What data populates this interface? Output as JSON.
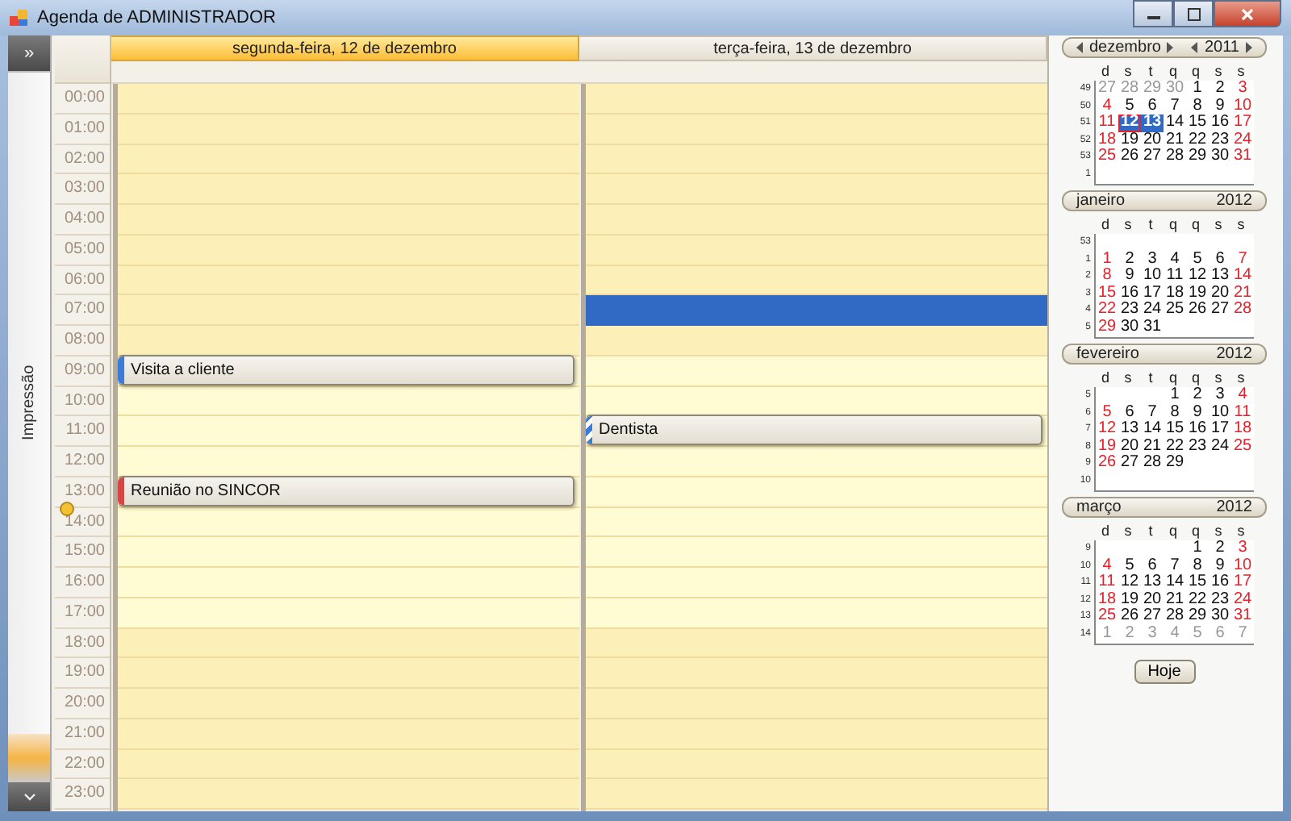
{
  "window": {
    "title": "Agenda de ADMINISTRADOR"
  },
  "sidebar": {
    "expand_button": "»",
    "tab": "Impressão"
  },
  "hours": [
    {
      "label": "00:00",
      "working": false,
      "now": false
    },
    {
      "label": "01:00",
      "working": false,
      "now": false
    },
    {
      "label": "02:00",
      "working": false,
      "now": false
    },
    {
      "label": "03:00",
      "working": false,
      "now": false
    },
    {
      "label": "04:00",
      "working": false,
      "now": false
    },
    {
      "label": "05:00",
      "working": false,
      "now": false
    },
    {
      "label": "06:00",
      "working": false,
      "now": false
    },
    {
      "label": "07:00",
      "working": false,
      "now": false
    },
    {
      "label": "08:00",
      "working": false,
      "now": false
    },
    {
      "label": "09:00",
      "working": true,
      "now": false
    },
    {
      "label": "10:00",
      "working": true,
      "now": false
    },
    {
      "label": "11:00",
      "working": true,
      "now": false
    },
    {
      "label": "12:00",
      "working": true,
      "now": false
    },
    {
      "label": "13:00",
      "working": true,
      "now": false
    },
    {
      "label": "14:00",
      "working": true,
      "now": true
    },
    {
      "label": "15:00",
      "working": true,
      "now": false
    },
    {
      "label": "16:00",
      "working": true,
      "now": false
    },
    {
      "label": "17:00",
      "working": true,
      "now": false
    },
    {
      "label": "18:00",
      "working": false,
      "now": false
    },
    {
      "label": "19:00",
      "working": false,
      "now": false
    },
    {
      "label": "20:00",
      "working": false,
      "now": false
    },
    {
      "label": "21:00",
      "working": false,
      "now": false
    },
    {
      "label": "22:00",
      "working": false,
      "now": false
    },
    {
      "label": "23:00",
      "working": false,
      "now": false
    }
  ],
  "days": [
    {
      "header": "segunda-feira, 12 de dezembro",
      "selected": true,
      "slots": [
        {
          "selected": false
        },
        {
          "selected": false
        },
        {
          "selected": false
        },
        {
          "selected": false
        },
        {
          "selected": false
        },
        {
          "selected": false
        },
        {
          "selected": false
        },
        {
          "selected": false
        },
        {
          "selected": false
        },
        {
          "selected": false,
          "event": {
            "title": "Visita a cliente",
            "kind": "solid",
            "color": "#3d7bd9"
          }
        },
        {
          "selected": false
        },
        {
          "selected": false
        },
        {
          "selected": false
        },
        {
          "selected": false,
          "event": {
            "title": "Reunião no SINCOR",
            "kind": "solid",
            "color": "#d94545"
          }
        },
        {
          "selected": false
        },
        {
          "selected": false
        },
        {
          "selected": false
        },
        {
          "selected": false
        },
        {
          "selected": false
        },
        {
          "selected": false
        },
        {
          "selected": false
        },
        {
          "selected": false
        },
        {
          "selected": false
        },
        {
          "selected": false
        }
      ]
    },
    {
      "header": "terça-feira, 13 de dezembro",
      "selected": false,
      "slots": [
        {
          "selected": false
        },
        {
          "selected": false
        },
        {
          "selected": false
        },
        {
          "selected": false
        },
        {
          "selected": false
        },
        {
          "selected": false
        },
        {
          "selected": false
        },
        {
          "selected": true
        },
        {
          "selected": false
        },
        {
          "selected": false
        },
        {
          "selected": false
        },
        {
          "selected": false,
          "event": {
            "title": "Dentista",
            "kind": "striped",
            "color": "#3d7bd9"
          }
        },
        {
          "selected": false
        },
        {
          "selected": false
        },
        {
          "selected": false
        },
        {
          "selected": false
        },
        {
          "selected": false
        },
        {
          "selected": false
        },
        {
          "selected": false
        },
        {
          "selected": false
        },
        {
          "selected": false
        },
        {
          "selected": false
        },
        {
          "selected": false
        },
        {
          "selected": false
        }
      ]
    }
  ],
  "months": [
    {
      "month": "dezembro",
      "year": "2011",
      "navigation": true,
      "weekdays": [
        "d",
        "s",
        "t",
        "q",
        "q",
        "s",
        "s"
      ],
      "weeks": [
        {
          "week": "49",
          "days": [
            {
              "n": "27",
              "kind": "other",
              "selected": false
            },
            {
              "n": "28",
              "kind": "other",
              "selected": false
            },
            {
              "n": "29",
              "kind": "other",
              "selected": false
            },
            {
              "n": "30",
              "kind": "other",
              "selected": false
            },
            {
              "n": "1",
              "kind": "day",
              "selected": false
            },
            {
              "n": "2",
              "kind": "day",
              "selected": false
            },
            {
              "n": "3",
              "kind": "day",
              "selected": false
            }
          ]
        },
        {
          "week": "50",
          "days": [
            {
              "n": "4",
              "kind": "day",
              "selected": false
            },
            {
              "n": "5",
              "kind": "day",
              "selected": false
            },
            {
              "n": "6",
              "kind": "day",
              "selected": false
            },
            {
              "n": "7",
              "kind": "day",
              "selected": false
            },
            {
              "n": "8",
              "kind": "day",
              "selected": false
            },
            {
              "n": "9",
              "kind": "day",
              "selected": false
            },
            {
              "n": "10",
              "kind": "day",
              "selected": false
            }
          ]
        },
        {
          "week": "51",
          "days": [
            {
              "n": "11",
              "kind": "day",
              "selected": false
            },
            {
              "n": "12",
              "kind": "today",
              "selected": true
            },
            {
              "n": "13",
              "kind": "day",
              "selected": true
            },
            {
              "n": "14",
              "kind": "day",
              "selected": false
            },
            {
              "n": "15",
              "kind": "day",
              "selected": false
            },
            {
              "n": "16",
              "kind": "day",
              "selected": false
            },
            {
              "n": "17",
              "kind": "day",
              "selected": false
            }
          ]
        },
        {
          "week": "52",
          "days": [
            {
              "n": "18",
              "kind": "day",
              "selected": false
            },
            {
              "n": "19",
              "kind": "day",
              "selected": false
            },
            {
              "n": "20",
              "kind": "day",
              "selected": false
            },
            {
              "n": "21",
              "kind": "day",
              "selected": false
            },
            {
              "n": "22",
              "kind": "day",
              "selected": false
            },
            {
              "n": "23",
              "kind": "day",
              "selected": false
            },
            {
              "n": "24",
              "kind": "day",
              "selected": false
            }
          ]
        },
        {
          "week": "53",
          "days": [
            {
              "n": "25",
              "kind": "day",
              "selected": false
            },
            {
              "n": "26",
              "kind": "day",
              "selected": false
            },
            {
              "n": "27",
              "kind": "day",
              "selected": false
            },
            {
              "n": "28",
              "kind": "day",
              "selected": false
            },
            {
              "n": "29",
              "kind": "day",
              "selected": false
            },
            {
              "n": "30",
              "kind": "day",
              "selected": false
            },
            {
              "n": "31",
              "kind": "day",
              "selected": false
            }
          ]
        },
        {
          "week": "1"
        }
      ]
    },
    {
      "month": "janeiro",
      "year": "2012",
      "navigation": false,
      "weekdays": [
        "d",
        "s",
        "t",
        "q",
        "q",
        "s",
        "s"
      ],
      "weeks": [
        {
          "week": "53"
        },
        {
          "week": "1",
          "days": [
            {
              "n": "1",
              "kind": "day",
              "selected": false
            },
            {
              "n": "2",
              "kind": "day",
              "selected": false
            },
            {
              "n": "3",
              "kind": "day",
              "selected": false
            },
            {
              "n": "4",
              "kind": "day",
              "selected": false
            },
            {
              "n": "5",
              "kind": "day",
              "selected": false
            },
            {
              "n": "6",
              "kind": "day",
              "selected": false
            },
            {
              "n": "7",
              "kind": "day",
              "selected": false
            }
          ]
        },
        {
          "week": "2",
          "days": [
            {
              "n": "8",
              "kind": "day",
              "selected": false
            },
            {
              "n": "9",
              "kind": "day",
              "selected": false
            },
            {
              "n": "10",
              "kind": "day",
              "selected": false
            },
            {
              "n": "11",
              "kind": "day",
              "selected": false
            },
            {
              "n": "12",
              "kind": "day",
              "selected": false
            },
            {
              "n": "13",
              "kind": "day",
              "selected": false
            },
            {
              "n": "14",
              "kind": "day",
              "selected": false
            }
          ]
        },
        {
          "week": "3",
          "days": [
            {
              "n": "15",
              "kind": "day",
              "selected": false
            },
            {
              "n": "16",
              "kind": "day",
              "selected": false
            },
            {
              "n": "17",
              "kind": "day",
              "selected": false
            },
            {
              "n": "18",
              "kind": "day",
              "selected": false
            },
            {
              "n": "19",
              "kind": "day",
              "selected": false
            },
            {
              "n": "20",
              "kind": "day",
              "selected": false
            },
            {
              "n": "21",
              "kind": "day",
              "selected": false
            }
          ]
        },
        {
          "week": "4",
          "days": [
            {
              "n": "22",
              "kind": "day",
              "selected": false
            },
            {
              "n": "23",
              "kind": "day",
              "selected": false
            },
            {
              "n": "24",
              "kind": "day",
              "selected": false
            },
            {
              "n": "25",
              "kind": "day",
              "selected": false
            },
            {
              "n": "26",
              "kind": "day",
              "selected": false
            },
            {
              "n": "27",
              "kind": "day",
              "selected": false
            },
            {
              "n": "28",
              "kind": "day",
              "selected": false
            }
          ]
        },
        {
          "week": "5",
          "days": [
            {
              "n": "29",
              "kind": "day",
              "selected": false
            },
            {
              "n": "30",
              "kind": "day",
              "selected": false
            },
            {
              "n": "31",
              "kind": "day",
              "selected": false
            }
          ]
        }
      ]
    },
    {
      "month": "fevereiro",
      "year": "2012",
      "navigation": false,
      "weekdays": [
        "d",
        "s",
        "t",
        "q",
        "q",
        "s",
        "s"
      ],
      "weeks": [
        {
          "week": "5",
          "days": [
            {
              "kind": "blank"
            },
            {
              "kind": "blank"
            },
            {
              "kind": "blank"
            },
            {
              "n": "1",
              "kind": "day",
              "selected": false
            },
            {
              "n": "2",
              "kind": "day",
              "selected": false
            },
            {
              "n": "3",
              "kind": "day",
              "selected": false
            },
            {
              "n": "4",
              "kind": "day",
              "selected": false
            }
          ]
        },
        {
          "week": "6",
          "days": [
            {
              "n": "5",
              "kind": "day",
              "selected": false
            },
            {
              "n": "6",
              "kind": "day",
              "selected": false
            },
            {
              "n": "7",
              "kind": "day",
              "selected": false
            },
            {
              "n": "8",
              "kind": "day",
              "selected": false
            },
            {
              "n": "9",
              "kind": "day",
              "selected": false
            },
            {
              "n": "10",
              "kind": "day",
              "selected": false
            },
            {
              "n": "11",
              "kind": "day",
              "selected": false
            }
          ]
        },
        {
          "week": "7",
          "days": [
            {
              "n": "12",
              "kind": "day",
              "selected": false
            },
            {
              "n": "13",
              "kind": "day",
              "selected": false
            },
            {
              "n": "14",
              "kind": "day",
              "selected": false
            },
            {
              "n": "15",
              "kind": "day",
              "selected": false
            },
            {
              "n": "16",
              "kind": "day",
              "selected": false
            },
            {
              "n": "17",
              "kind": "day",
              "selected": false
            },
            {
              "n": "18",
              "kind": "day",
              "selected": false
            }
          ]
        },
        {
          "week": "8",
          "days": [
            {
              "n": "19",
              "kind": "day",
              "selected": false
            },
            {
              "n": "20",
              "kind": "day",
              "selected": false
            },
            {
              "n": "21",
              "kind": "day",
              "selected": false
            },
            {
              "n": "22",
              "kind": "day",
              "selected": false
            },
            {
              "n": "23",
              "kind": "day",
              "selected": false
            },
            {
              "n": "24",
              "kind": "day",
              "selected": false
            },
            {
              "n": "25",
              "kind": "day",
              "selected": false
            }
          ]
        },
        {
          "week": "9",
          "days": [
            {
              "n": "26",
              "kind": "day",
              "selected": false
            },
            {
              "n": "27",
              "kind": "day",
              "selected": false
            },
            {
              "n": "28",
              "kind": "day",
              "selected": false
            },
            {
              "n": "29",
              "kind": "day",
              "selected": false
            }
          ]
        },
        {
          "week": "10"
        }
      ]
    },
    {
      "month": "março",
      "year": "2012",
      "navigation": false,
      "weekdays": [
        "d",
        "s",
        "t",
        "q",
        "q",
        "s",
        "s"
      ],
      "weeks": [
        {
          "week": "9",
          "days": [
            {
              "kind": "blank"
            },
            {
              "kind": "blank"
            },
            {
              "kind": "blank"
            },
            {
              "kind": "blank"
            },
            {
              "n": "1",
              "kind": "day",
              "selected": false
            },
            {
              "n": "2",
              "kind": "day",
              "selected": false
            },
            {
              "n": "3",
              "kind": "day",
              "selected": false
            }
          ]
        },
        {
          "week": "10",
          "days": [
            {
              "n": "4",
              "kind": "day",
              "selected": false
            },
            {
              "n": "5",
              "kind": "day",
              "selected": false
            },
            {
              "n": "6",
              "kind": "day",
              "selected": false
            },
            {
              "n": "7",
              "kind": "day",
              "selected": false
            },
            {
              "n": "8",
              "kind": "day",
              "selected": false
            },
            {
              "n": "9",
              "kind": "day",
              "selected": false
            },
            {
              "n": "10",
              "kind": "day",
              "selected": false
            }
          ]
        },
        {
          "week": "11",
          "days": [
            {
              "n": "11",
              "kind": "day",
              "selected": false
            },
            {
              "n": "12",
              "kind": "day",
              "selected": false
            },
            {
              "n": "13",
              "kind": "day",
              "selected": false
            },
            {
              "n": "14",
              "kind": "day",
              "selected": false
            },
            {
              "n": "15",
              "kind": "day",
              "selected": false
            },
            {
              "n": "16",
              "kind": "day",
              "selected": false
            },
            {
              "n": "17",
              "kind": "day",
              "selected": false
            }
          ]
        },
        {
          "week": "12",
          "days": [
            {
              "n": "18",
              "kind": "day",
              "selected": false
            },
            {
              "n": "19",
              "kind": "day",
              "selected": false
            },
            {
              "n": "20",
              "kind": "day",
              "selected": false
            },
            {
              "n": "21",
              "kind": "day",
              "selected": false
            },
            {
              "n": "22",
              "kind": "day",
              "selected": false
            },
            {
              "n": "23",
              "kind": "day",
              "selected": false
            },
            {
              "n": "24",
              "kind": "day",
              "selected": false
            }
          ]
        },
        {
          "week": "13",
          "days": [
            {
              "n": "25",
              "kind": "day",
              "selected": false
            },
            {
              "n": "26",
              "kind": "day",
              "selected": false
            },
            {
              "n": "27",
              "kind": "day",
              "selected": false
            },
            {
              "n": "28",
              "kind": "day",
              "selected": false
            },
            {
              "n": "29",
              "kind": "day",
              "selected": false
            },
            {
              "n": "30",
              "kind": "day",
              "selected": false
            },
            {
              "n": "31",
              "kind": "day",
              "selected": false
            }
          ]
        },
        {
          "week": "14",
          "days": [
            {
              "n": "1",
              "kind": "other",
              "selected": false
            },
            {
              "n": "2",
              "kind": "other",
              "selected": false
            },
            {
              "n": "3",
              "kind": "other",
              "selected": false
            },
            {
              "n": "4",
              "kind": "other",
              "selected": false
            },
            {
              "n": "5",
              "kind": "other",
              "selected": false
            },
            {
              "n": "6",
              "kind": "other",
              "selected": false
            },
            {
              "n": "7",
              "kind": "other",
              "selected": false
            }
          ]
        }
      ]
    }
  ],
  "today_button": "Hoje"
}
